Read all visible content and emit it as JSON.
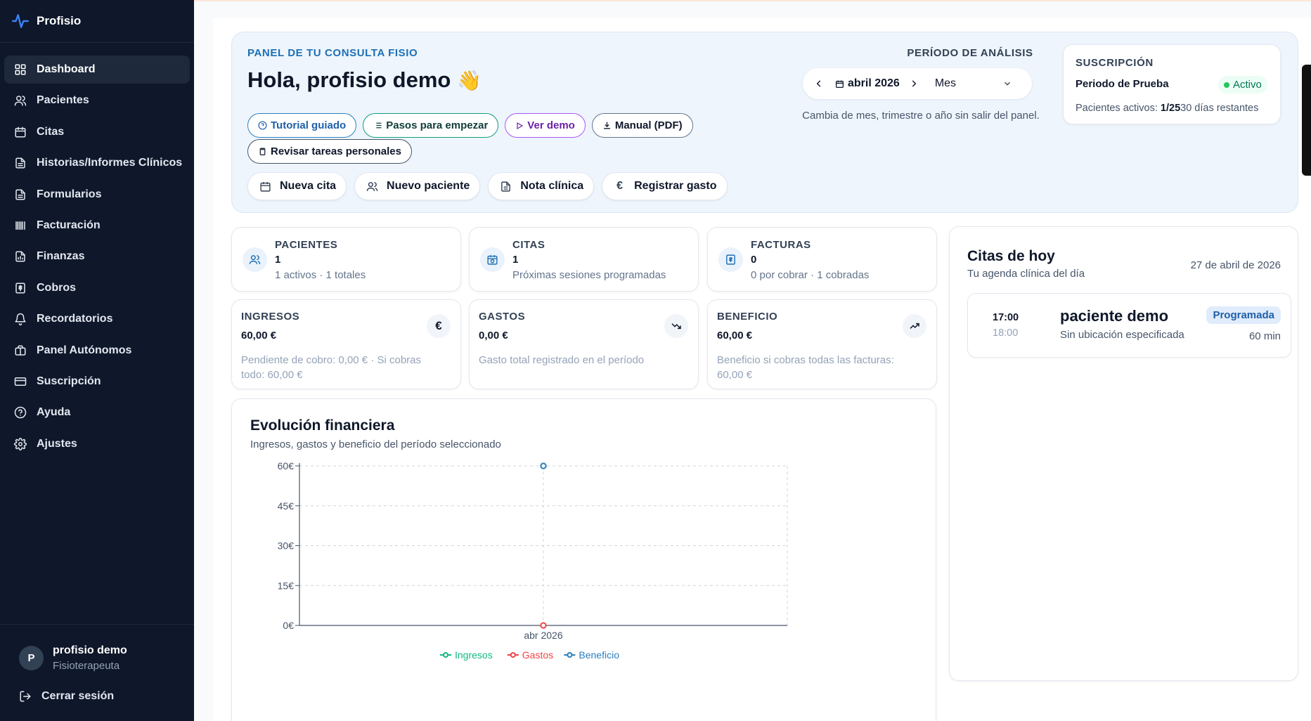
{
  "brand": {
    "name": "Profisio",
    "accent": "#2b7fbf"
  },
  "sidebar": {
    "items": [
      {
        "label": "Dashboard",
        "icon": "grid-icon",
        "active": true
      },
      {
        "label": "Pacientes",
        "icon": "users-icon"
      },
      {
        "label": "Citas",
        "icon": "calendar-icon"
      },
      {
        "label": "Historias/Informes Clínicos",
        "icon": "file-text-icon"
      },
      {
        "label": "Formularios",
        "icon": "file-text-icon"
      },
      {
        "label": "Facturación",
        "icon": "barcode-icon"
      },
      {
        "label": "Finanzas",
        "icon": "file-chart-icon"
      },
      {
        "label": "Cobros",
        "icon": "receipt-icon"
      },
      {
        "label": "Recordatorios",
        "icon": "bell-icon"
      },
      {
        "label": "Panel Autónomos",
        "icon": "briefcase-icon"
      },
      {
        "label": "Suscripción",
        "icon": "credit-card-icon"
      },
      {
        "label": "Ayuda",
        "icon": "help-circle-icon"
      },
      {
        "label": "Ajustes",
        "icon": "gear-icon"
      }
    ],
    "user": {
      "initial": "P",
      "name": "profisio demo",
      "role": "Fisioterapeuta"
    },
    "logout_label": "Cerrar sesión"
  },
  "hero": {
    "eyebrow": "PANEL DE TU CONSULTA FISIO",
    "greeting": "Hola, profisio demo",
    "greeting_emoji": "👋",
    "pills": [
      {
        "label": "Tutorial guiado",
        "icon": "help-circle-icon"
      },
      {
        "label": "Pasos para empezar",
        "icon": "list-icon"
      },
      {
        "label": "Ver demo",
        "icon": "play-icon"
      },
      {
        "label": "Manual (PDF)",
        "icon": "download-icon"
      }
    ],
    "pill_tasks": {
      "label": "Revisar tareas personales",
      "icon": "clipboard-icon"
    },
    "actions": [
      {
        "label": "Nueva cita",
        "icon": "calendar-icon"
      },
      {
        "label": "Nuevo paciente",
        "icon": "users-icon"
      },
      {
        "label": "Nota clínica",
        "icon": "file-text-icon"
      },
      {
        "label": "Registrar gasto",
        "icon": "euro-icon"
      }
    ]
  },
  "period": {
    "label": "PERÍODO DE ANÁLISIS",
    "current": "abril 2026",
    "granularity": "Mes",
    "hint": "Cambia de mes, trimestre o año sin salir del panel."
  },
  "subscription": {
    "title": "SUSCRIPCIÓN",
    "plan": "Periodo de Prueba",
    "status": "Activo",
    "patients_prefix": "Pacientes activos:",
    "patients_value": "1/25",
    "days_left": "30 días restantes"
  },
  "stats": [
    {
      "label": "PACIENTES",
      "value": "1",
      "detail": "1 activos · 1 totales",
      "icon": "users-icon"
    },
    {
      "label": "CITAS",
      "value": "1",
      "detail": "Próximas sesiones programadas",
      "icon": "calendar-clock-icon"
    },
    {
      "label": "FACTURAS",
      "value": "0",
      "detail": "0 por cobrar · 1 cobradas",
      "icon": "invoice-icon"
    }
  ],
  "finances": [
    {
      "label": "INGRESOS",
      "value": "60,00 €",
      "detail": "Pendiente de cobro: 0,00 € · Si cobras todo: 60,00 €",
      "icon": "euro-icon"
    },
    {
      "label": "GASTOS",
      "value": "0,00 €",
      "detail": "Gasto total registrado en el período",
      "icon": "trending-down-icon"
    },
    {
      "label": "BENEFICIO",
      "value": "60,00 €",
      "detail": "Beneficio si cobras todas las facturas: 60,00 €",
      "icon": "trending-up-icon"
    }
  ],
  "chart_section": {
    "title": "Evolución financiera",
    "subtitle": "Ingresos, gastos y beneficio del período seleccionado"
  },
  "chart_data": {
    "type": "line",
    "categories": [
      "abr 2026"
    ],
    "series": [
      {
        "name": "Ingresos",
        "values": [
          60
        ],
        "color": "#10b981"
      },
      {
        "name": "Gastos",
        "values": [
          0
        ],
        "color": "#ef4444"
      },
      {
        "name": "Beneficio",
        "values": [
          60
        ],
        "color": "#2b7fbf"
      }
    ],
    "y_ticks": [
      "0€",
      "15€",
      "30€",
      "45€",
      "60€"
    ],
    "ylim": [
      0,
      60
    ],
    "grid": true,
    "legend": "bottom-center"
  },
  "today": {
    "title": "Citas de hoy",
    "subtitle": "Tu agenda clínica del día",
    "date": "27 de abril de 2026",
    "appointments": [
      {
        "start": "17:00",
        "end": "18:00",
        "patient": "paciente demo",
        "location": "Sin ubicación especificada",
        "status": "Programada",
        "duration": "60 min"
      }
    ]
  }
}
